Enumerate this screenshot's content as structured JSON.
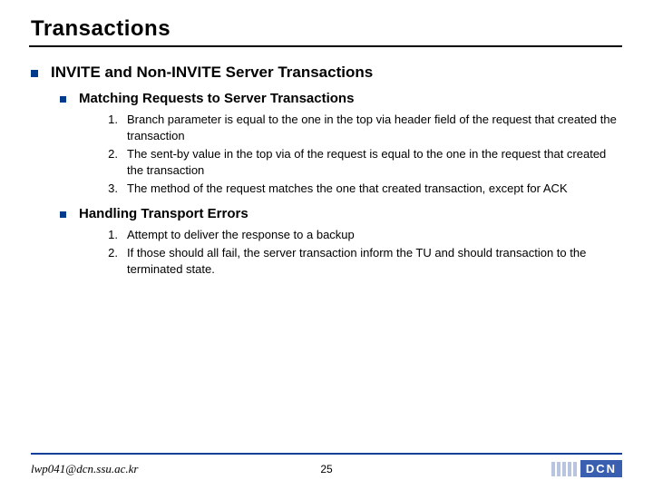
{
  "title": "Transactions",
  "heading": "INVITE and Non-INVITE Server Transactions",
  "sections": [
    {
      "title": "Matching Requests to Server Transactions",
      "items": [
        "Branch parameter is equal to the one in the top via header field of the request that created the transaction",
        "The sent-by value in the top via of the request is equal to the one in the request that created the transaction",
        "The method of the request matches the one that created transaction, except for ACK"
      ]
    },
    {
      "title": "Handling Transport Errors",
      "items": [
        "Attempt to deliver the response to a backup",
        "If those should all fail, the server transaction inform the TU and should transaction to the terminated state."
      ]
    }
  ],
  "footer": {
    "email": "lwp041@dcn.ssu.ac.kr",
    "page": "25",
    "logo": "DCN"
  }
}
